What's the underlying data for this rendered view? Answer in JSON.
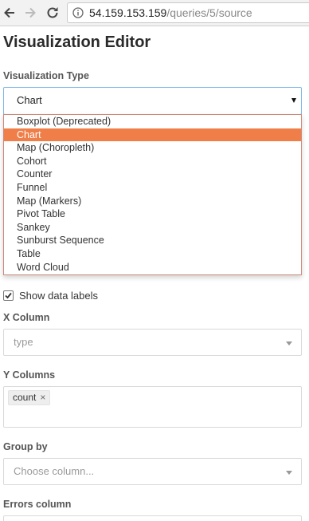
{
  "browser": {
    "url_host": "54.159.153.159",
    "url_path": "/queries/5/source"
  },
  "editor": {
    "title": "Visualization Editor",
    "viz_type": {
      "label": "Visualization Type",
      "selected": "Chart",
      "options": [
        "Boxplot (Deprecated)",
        "Chart",
        "Map (Choropleth)",
        "Cohort",
        "Counter",
        "Funnel",
        "Map (Markers)",
        "Pivot Table",
        "Sankey",
        "Sunburst Sequence",
        "Table",
        "Word Cloud"
      ],
      "highlighted_index": 1
    },
    "show_data_labels": {
      "label": "Show data labels",
      "checked": true
    },
    "x_column": {
      "label": "X Column",
      "placeholder": "type"
    },
    "y_columns": {
      "label": "Y Columns",
      "tags": [
        "count"
      ],
      "remove_glyph": "×"
    },
    "group_by": {
      "label": "Group by",
      "placeholder": "Choose column..."
    },
    "errors_column": {
      "label": "Errors column"
    }
  },
  "colors": {
    "highlight": "#f07e48",
    "focus_border": "#7cb7e8"
  }
}
